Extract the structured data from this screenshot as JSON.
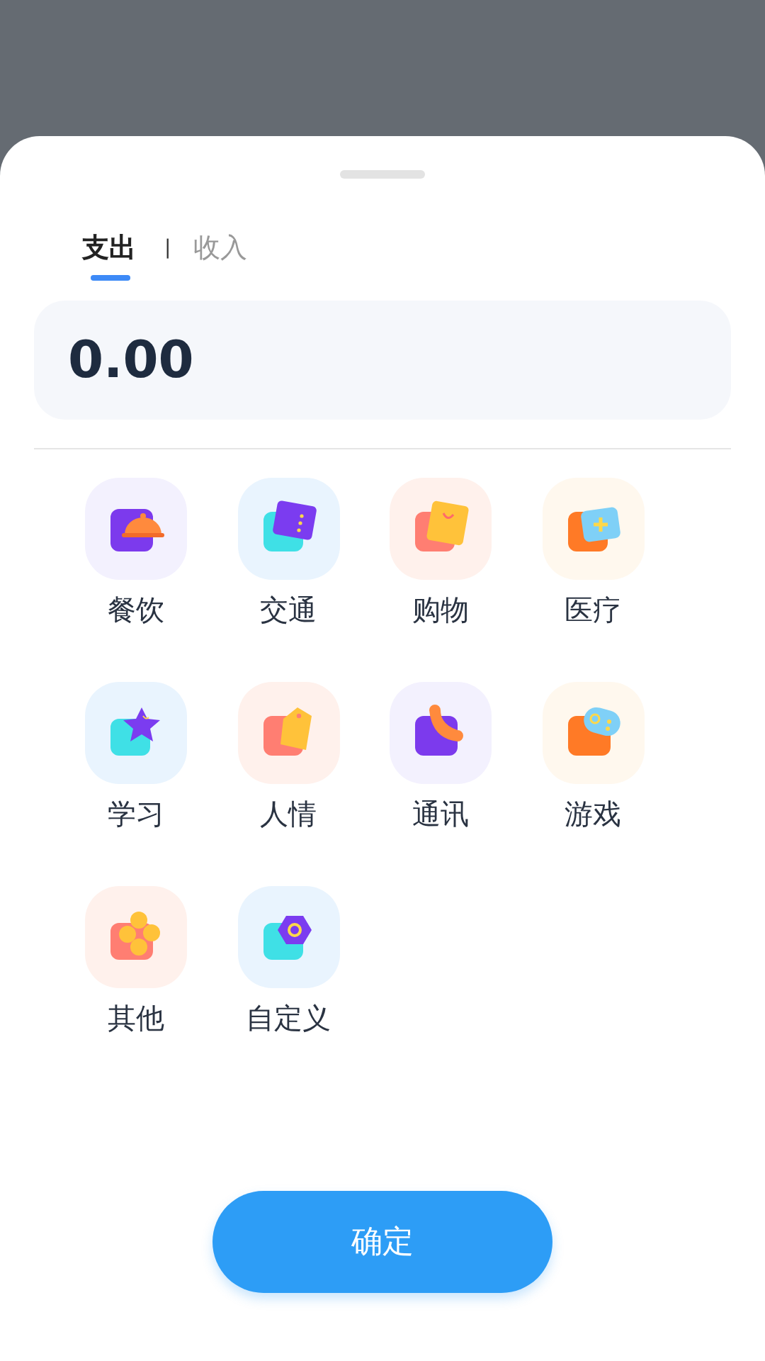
{
  "tabs": [
    {
      "label": "支出",
      "selected": true
    },
    {
      "label": "收入",
      "selected": false
    }
  ],
  "tab_separator": "|",
  "amount": {
    "value": "0.00"
  },
  "categories": [
    {
      "label": "餐饮"
    },
    {
      "label": "交通"
    },
    {
      "label": "购物"
    },
    {
      "label": "医疗"
    },
    {
      "label": "学习"
    },
    {
      "label": "人情"
    },
    {
      "label": "通讯"
    },
    {
      "label": "游戏"
    },
    {
      "label": "其他"
    },
    {
      "label": "自定义"
    }
  ],
  "confirm_button": "确定"
}
